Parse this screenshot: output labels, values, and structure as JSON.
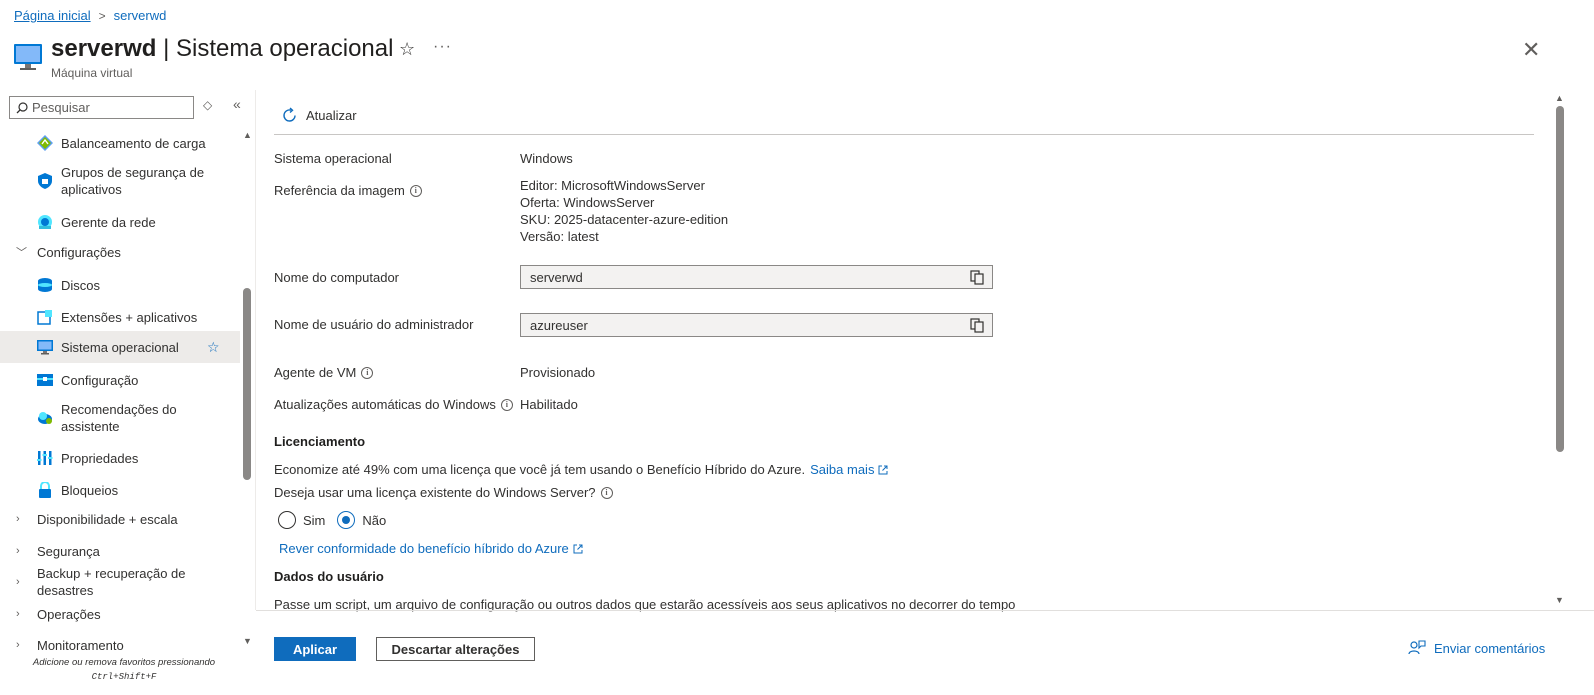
{
  "breadcrumb": {
    "home": "Página inicial",
    "sep": ">",
    "current": "serverwd"
  },
  "header": {
    "resource": "serverwd",
    "separator": " | ",
    "page": "Sistema operacional",
    "subtitle": "Máquina virtual"
  },
  "sidebar": {
    "search_placeholder": "Pesquisar",
    "items": [
      {
        "label": "Balanceamento de carga"
      },
      {
        "label": "Grupos de segurança de aplicativos"
      },
      {
        "label": "Gerente da rede"
      },
      {
        "label": "Configurações"
      },
      {
        "label": "Discos"
      },
      {
        "label": "Extensões + aplicativos"
      },
      {
        "label": "Sistema operacional"
      },
      {
        "label": "Configuração"
      },
      {
        "label": "Recomendações do assistente"
      },
      {
        "label": "Propriedades"
      },
      {
        "label": "Bloqueios"
      },
      {
        "label": "Disponibilidade + escala"
      },
      {
        "label": "Segurança"
      },
      {
        "label": "Backup + recuperação de desastres"
      },
      {
        "label": "Operações"
      },
      {
        "label": "Monitoramento"
      }
    ],
    "fav_hint_line1": "Adicione ou remova favoritos pressionando",
    "fav_hint_line2": "Ctrl+Shift+F"
  },
  "toolbar": {
    "refresh_label": "Atualizar"
  },
  "details": {
    "os_label": "Sistema operacional",
    "os_value": "Windows",
    "image_ref_label": "Referência da imagem",
    "image_ref": {
      "publisher": "Editor: MicrosoftWindowsServer",
      "offer": "Oferta: WindowsServer",
      "sku": "SKU: 2025-datacenter-azure-edition",
      "version": "Versão: latest"
    },
    "computer_name_label": "Nome do computador",
    "computer_name_value": "serverwd",
    "admin_user_label": "Nome de usuário do administrador",
    "admin_user_value": "azureuser",
    "vm_agent_label": "Agente de VM",
    "vm_agent_value": "Provisionado",
    "auto_updates_label": "Atualizações automáticas do Windows",
    "auto_updates_value": "Habilitado"
  },
  "licensing": {
    "heading": "Licenciamento",
    "text": "Economize até 49% com uma licença que você já tem usando o Benefício Híbrido do Azure.",
    "learn_more": "Saiba mais",
    "question": "Deseja usar uma licença existente do Windows Server?",
    "yes": "Sim",
    "no": "Não",
    "selected": "Não",
    "review_link": "Rever conformidade do benefício híbrido do Azure"
  },
  "user_data": {
    "heading": "Dados do usuário",
    "text": "Passe um script, um arquivo de configuração ou outros dados que estarão acessíveis aos seus aplicativos no decorrer do tempo"
  },
  "footer": {
    "apply": "Aplicar",
    "discard": "Descartar alterações",
    "feedback": "Enviar comentários"
  },
  "colors": {
    "accent": "#0f6cbd",
    "selected_bg": "#edebe9",
    "readonly_bg": "#f3f2f1"
  }
}
